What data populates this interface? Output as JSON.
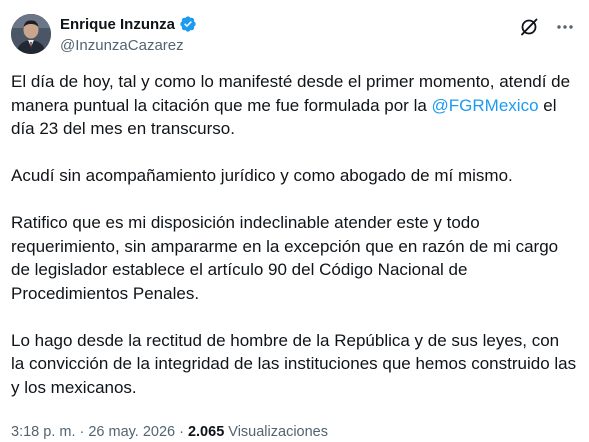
{
  "author": {
    "display_name": "Enrique Inzunza",
    "handle": "@InzunzaCazarez",
    "verified_icon": "verified-badge-icon"
  },
  "actions": {
    "grok_icon": "grok-icon",
    "more_icon": "more-icon"
  },
  "body": {
    "p1_before": "El día de hoy, tal y como lo manifesté desde el primer momento, atendí de manera puntual la citación que me fue formulada por la ",
    "p1_mention": "@FGRMexico",
    "p1_after": " el día 23 del mes en transcurso.",
    "p2": "Acudí sin acompañamiento jurídico y como abogado de mí mismo.",
    "p3": "Ratifico que es mi disposición indeclinable atender este y todo requerimiento, sin ampararme en la excepción que en razón de mi cargo de legislador establece el artículo 90 del Código Nacional de Procedimientos Penales.",
    "p4": "Lo hago desde la rectitud de hombre de la República y de sus leyes, con la convicción de la integridad de las instituciones que hemos construido las y los mexicanos."
  },
  "meta": {
    "time": "3:18 p. m.",
    "separator": "·",
    "date": "26 may. 2026",
    "views_count": "2.065",
    "views_label": "Visualizaciones"
  },
  "colors": {
    "text": "#0f1419",
    "secondary": "#536471",
    "accent": "#1d9bf0"
  }
}
